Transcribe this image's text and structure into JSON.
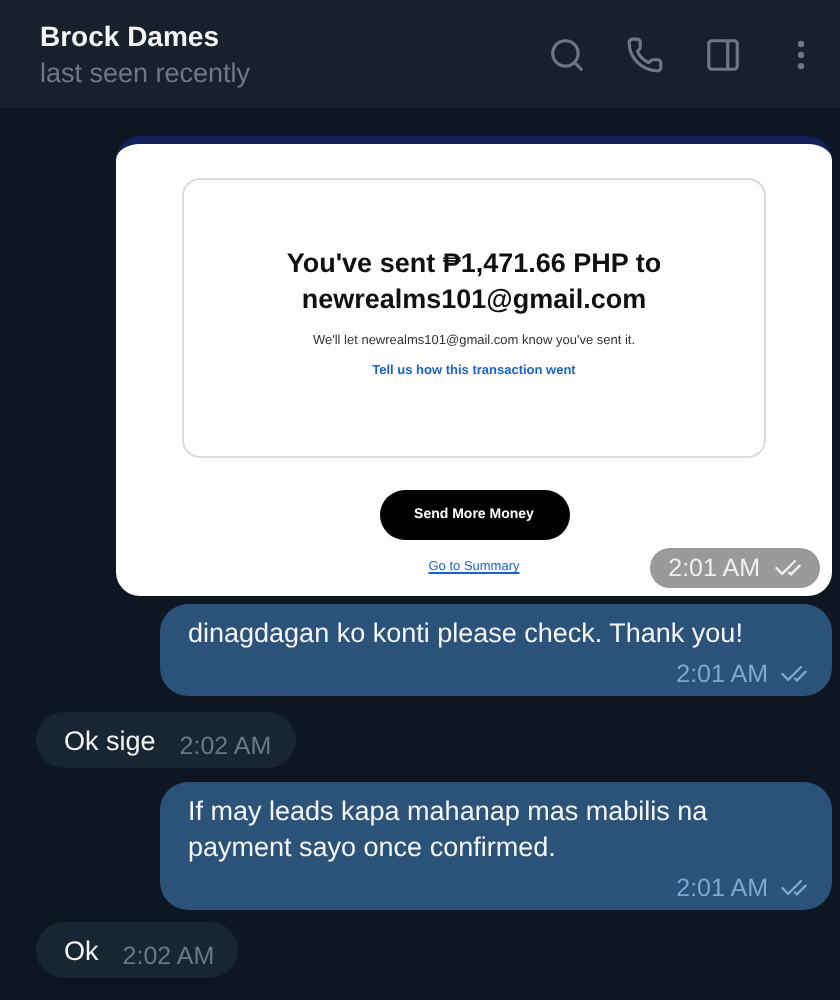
{
  "header": {
    "name": "Brock Dames",
    "status": "last seen recently"
  },
  "messages": [
    {
      "kind": "image",
      "outgoing": true,
      "time": "2:01 AM",
      "read": true,
      "screenshot": {
        "title": "You've sent ₱1,471.66 PHP to newrealms101@gmail.com",
        "note": "We'll let newrealms101@gmail.com know you've sent it.",
        "feedback_link": "Tell us how this transaction went",
        "button": "Send More Money",
        "summary_link": "Go to Summary"
      }
    },
    {
      "kind": "text",
      "outgoing": true,
      "text": "dinagdagan ko konti please check. Thank you!",
      "time": "2:01 AM",
      "read": true
    },
    {
      "kind": "text",
      "outgoing": false,
      "text": "Ok sige",
      "time": "2:02 AM"
    },
    {
      "kind": "text",
      "outgoing": true,
      "text": "If may leads kapa mahanap mas mabilis na payment sayo once confirmed.",
      "time": "2:01 AM",
      "read": true
    },
    {
      "kind": "text",
      "outgoing": false,
      "text": "Ok",
      "time": "2:02 AM"
    }
  ]
}
